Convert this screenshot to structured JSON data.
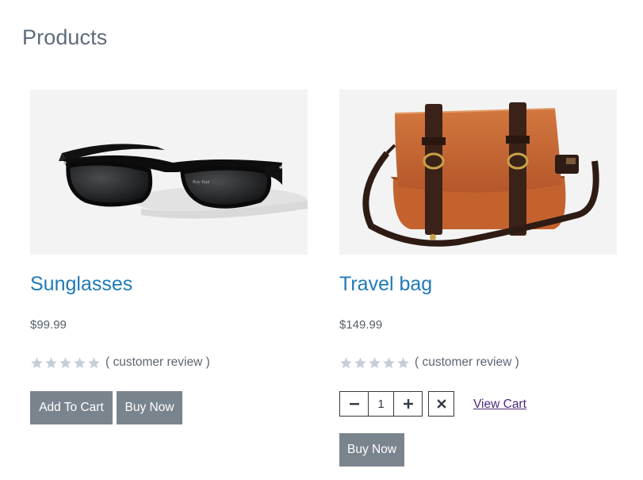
{
  "page": {
    "title": "Products"
  },
  "colors": {
    "link": "#1f7ab8",
    "button": "#7a848d",
    "star_empty": "#c6ced7",
    "visited_link": "#4b2a7a"
  },
  "products": [
    {
      "name": "Sunglasses",
      "price": "$99.99",
      "rating": 0,
      "review_text": "( customer review )",
      "image_icon": "sunglasses-image",
      "add_to_cart_label": "Add To Cart",
      "buy_now_label": "Buy Now"
    },
    {
      "name": "Travel bag",
      "price": "$149.99",
      "rating": 0,
      "review_text": "( customer review )",
      "image_icon": "travel-bag-image",
      "quantity": "1",
      "minus_icon": "minus-icon",
      "plus_icon": "plus-icon",
      "remove_icon": "close-icon",
      "view_cart_label": "View Cart",
      "buy_now_label": "Buy Now"
    }
  ]
}
